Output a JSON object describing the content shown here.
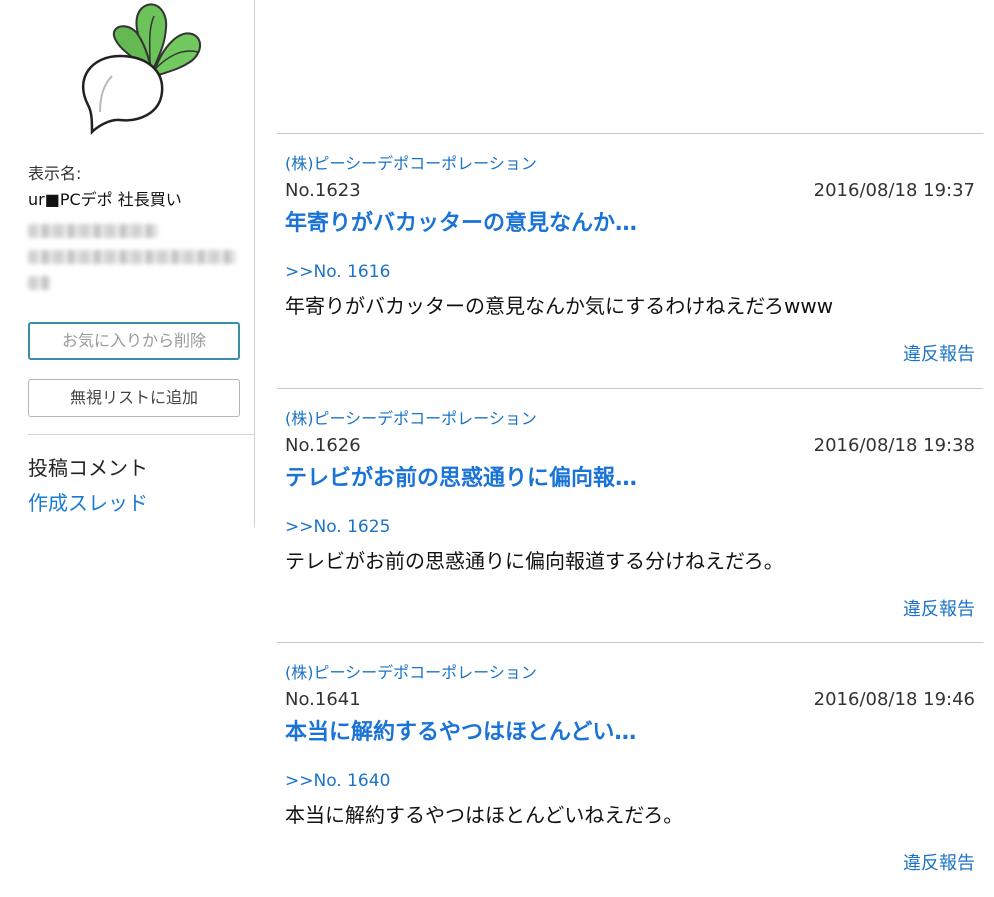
{
  "profile": {
    "display_name_label": "表示名:",
    "display_name_value": "ur■PCデポ 社長買い",
    "favorite_button": "お気に入りから削除",
    "ignore_button": "無視リストに追加",
    "comments_link": "投稿コメント",
    "threads_link": "作成スレッド"
  },
  "posts": [
    {
      "company": "(株)ピーシーデポコーポレーション",
      "number": "No.1623",
      "datetime": "2016/08/18 19:37",
      "title": "年寄りがバカッターの意見なんか…",
      "reply_to": ">>No. 1616",
      "body": "年寄りがバカッターの意見なんか気にするわけねえだろwww",
      "report": "違反報告"
    },
    {
      "company": "(株)ピーシーデポコーポレーション",
      "number": "No.1626",
      "datetime": "2016/08/18 19:38",
      "title": "テレビがお前の思惑通りに偏向報…",
      "reply_to": ">>No. 1625",
      "body": "テレビがお前の思惑通りに偏向報道する分けねえだろ。",
      "report": "違反報告"
    },
    {
      "company": "(株)ピーシーデポコーポレーション",
      "number": "No.1641",
      "datetime": "2016/08/18 19:46",
      "title": "本当に解約するやつはほとんどい…",
      "reply_to": ">>No. 1640",
      "body": "本当に解約するやつはほとんどいねえだろ。",
      "report": "違反報告"
    }
  ],
  "colors": {
    "link": "#1a73c8",
    "title": "#1a73d6",
    "button_focus_border": "#3a8fa6"
  }
}
